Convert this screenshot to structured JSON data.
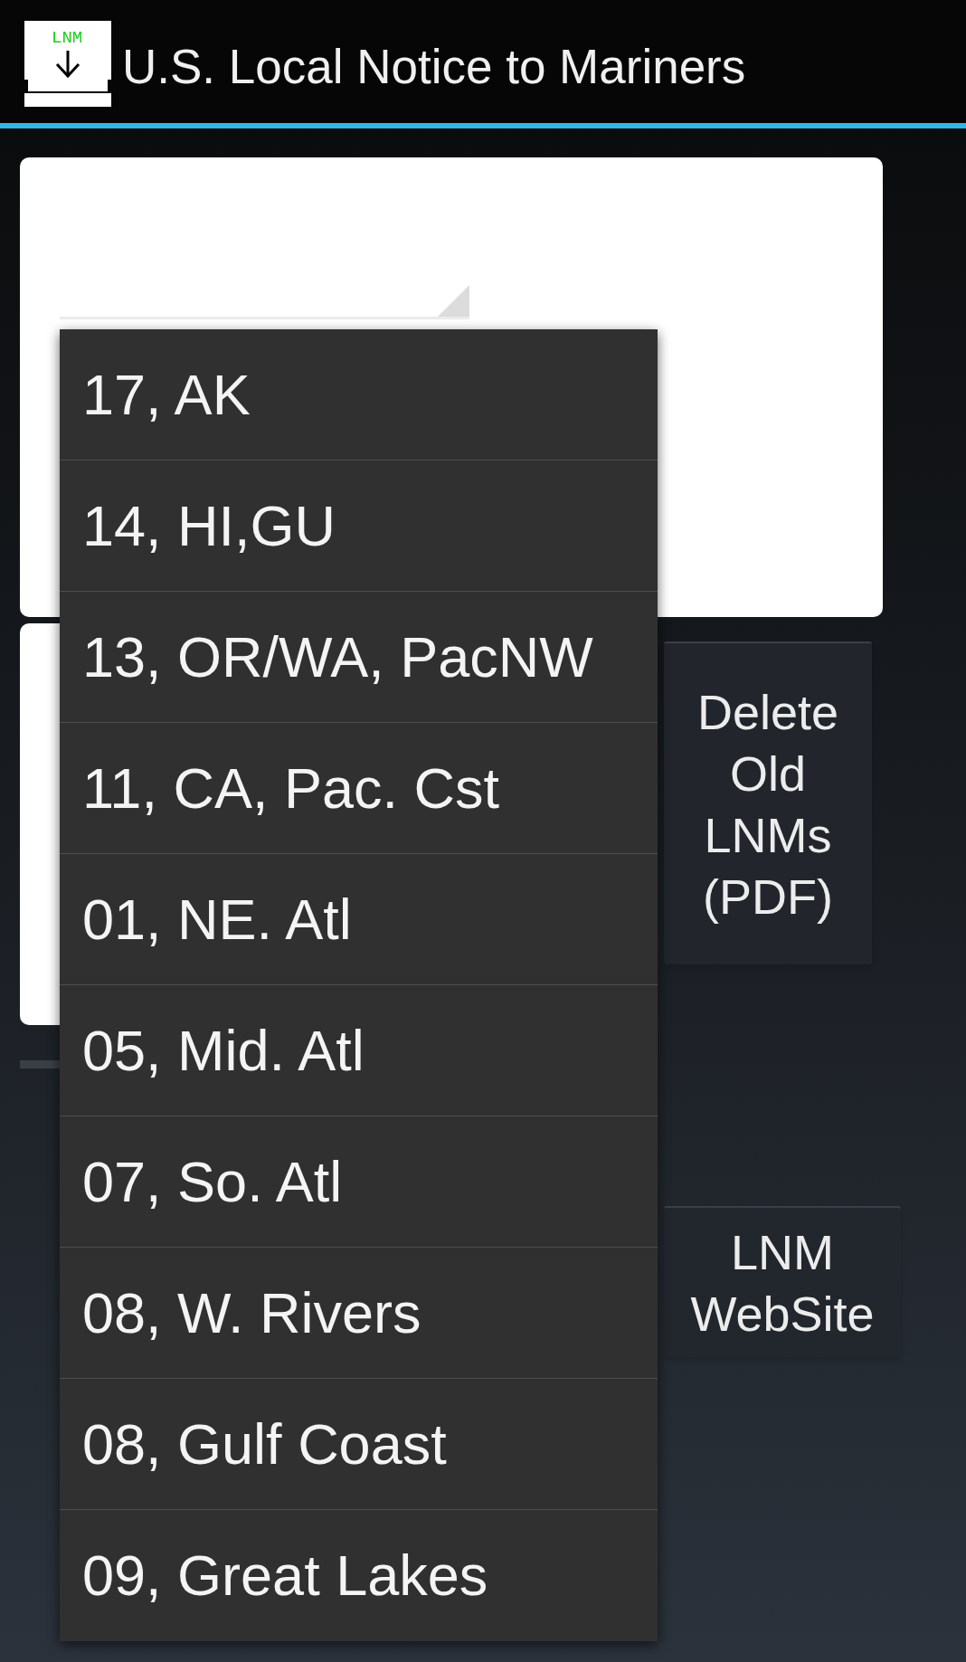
{
  "app_bar": {
    "logo_text": "LNM",
    "title": "U.S. Local Notice to Mariners"
  },
  "region_dropdown": {
    "expanded": true,
    "options": [
      {
        "label": "17, AK",
        "selected": false
      },
      {
        "label": "14, HI,GU",
        "selected": false
      },
      {
        "label": "13, OR/WA, PacNW",
        "selected": false
      },
      {
        "label": "11, CA, Pac. Cst",
        "selected": false
      },
      {
        "label": "01, NE. Atl",
        "selected": false
      },
      {
        "label": "05, Mid. Atl",
        "selected": false
      },
      {
        "label": "07, So. Atl",
        "selected": false
      },
      {
        "label": "08, W. Rivers",
        "selected": false
      },
      {
        "label": "08, Gulf Coast",
        "selected": false
      },
      {
        "label": "09, Great Lakes",
        "selected": false
      }
    ]
  },
  "delete_button": {
    "label": "Delete Old LNMs (PDF)"
  },
  "website_button": {
    "label": "LNM WebSite"
  }
}
